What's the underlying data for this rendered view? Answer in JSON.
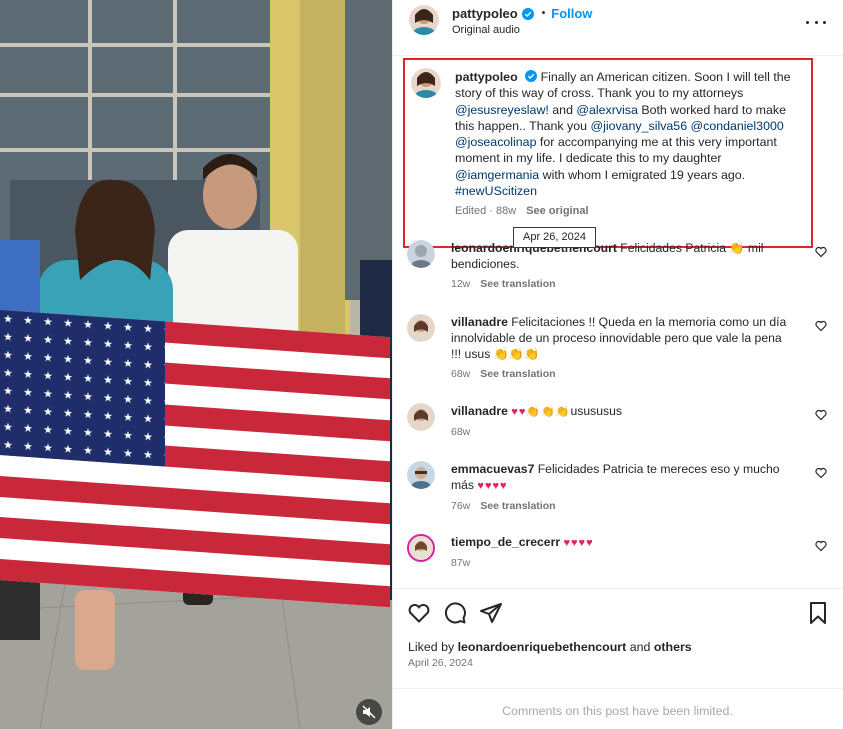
{
  "header": {
    "username": "pattypoleo",
    "separator": "•",
    "follow_label": "Follow",
    "audio": "Original audio"
  },
  "caption": {
    "username": "pattypoleo",
    "text_1": "Finally an American citizen. Soon I will tell the story of this way of cross. Thank you to my attorneys ",
    "mention_1": "@jesusreyeslaw!",
    "text_2": " and ",
    "mention_2": "@alexrvisa",
    "text_3": " Both worked hard to make this happen.. Thank you ",
    "mention_3": "@jiovany_silva56",
    "text_4": " ",
    "mention_4": "@condaniel3000",
    "text_5": " ",
    "mention_5": "@joseacolinap",
    "text_6": " for accompanying me at this very important moment in my life. I dedicate this to my daughter ",
    "mention_6": "@iamgermania",
    "text_7": " with whom I emigrated 19 years ago. ",
    "hashtag": "#newUScitizen",
    "edited": "Edited · 88w",
    "see_original": "See original",
    "tooltip": "Apr 26, 2024"
  },
  "comments": [
    {
      "username": "leonardoenriquebethencourt",
      "text": "Felicidades Patricia 👏 mil bendiciones.",
      "time": "12w",
      "translate": "See translation"
    },
    {
      "username": "villanadre",
      "text": "Felicitaciones !! Queda en la memoria como un día innolvidable de un proceso innovidable pero que vale la pena !!! usus",
      "emoji": "👏👏👏",
      "time": "68w",
      "translate": "See translation"
    },
    {
      "username": "villanadre",
      "text": "usususus",
      "emoji": "♥♥👏👏👏",
      "time": "68w",
      "translate": ""
    },
    {
      "username": "emmacuevas7",
      "text": "Felicidades Patricia te mereces eso y mucho más",
      "emoji": "♥♥♥♥",
      "time": "76w",
      "translate": "See translation"
    },
    {
      "username": "tiempo_de_crecerr",
      "text": "",
      "emoji": "♥♥♥♥",
      "time": "87w",
      "translate": ""
    }
  ],
  "footer": {
    "liked_prefix": "Liked by ",
    "liked_user": "leonardoenriquebethencourt",
    "liked_mid": " and ",
    "liked_others": "others",
    "date": "April 26, 2024",
    "limited": "Comments on this post have been limited."
  },
  "colors": {
    "link": "#00376b",
    "follow": "#0095f6",
    "highlight_box": "#e0262a",
    "meta": "#737373"
  }
}
